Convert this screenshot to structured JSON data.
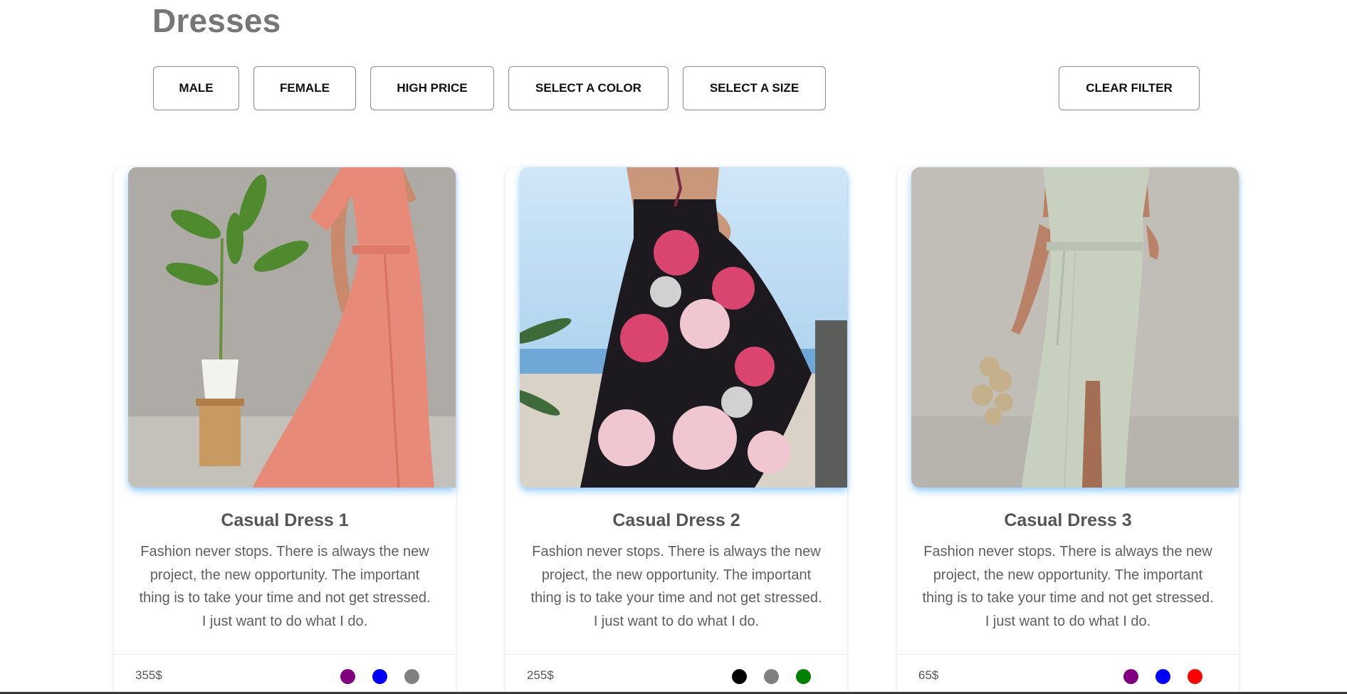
{
  "page": {
    "title": "Dresses"
  },
  "filters": {
    "male": "MALE",
    "female": "FEMALE",
    "high_price": "HIGH PRICE",
    "select_color": "SELECT A COLOR",
    "select_size": "SELECT A SIZE",
    "clear": "CLEAR FILTER"
  },
  "products": [
    {
      "title": "Casual Dress 1",
      "description": "Fashion never stops. There is always the new project, the new opportunity. The important thing is to take your time and not get stressed. I just want to do what I do.",
      "price": "355$",
      "image": "coral-maxi-dress-photo",
      "colors": [
        "#800080",
        "#0000ff",
        "#808080"
      ]
    },
    {
      "title": "Casual Dress 2",
      "description": "Fashion never stops. There is always the new project, the new opportunity. The important thing is to take your time and not get stressed. I just want to do what I do.",
      "price": "255$",
      "image": "floral-halter-dress-photo",
      "colors": [
        "#000000",
        "#808080",
        "#008000"
      ]
    },
    {
      "title": "Casual Dress 3",
      "description": "Fashion never stops. There is always the new project, the new opportunity. The important thing is to take your time and not get stressed. I just want to do what I do.",
      "price": "65$",
      "image": "sage-wrap-dress-photo",
      "colors": [
        "#800080",
        "#0000ff",
        "#ff0000"
      ]
    }
  ]
}
